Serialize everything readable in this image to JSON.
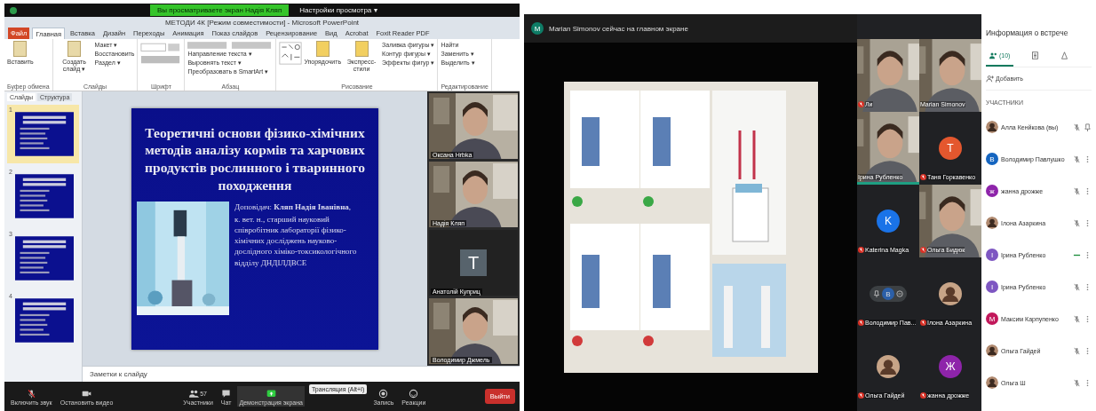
{
  "left_screen": {
    "share_banner": "Вы просматриваете экран Надія Кляп",
    "view_options": "Настройки просмотра ▾",
    "powerpoint": {
      "title": "МЕТОДИ 4К [Режим совместимости] - Microsoft PowerPoint",
      "ribbon_tabs": [
        {
          "label": "Файл",
          "kind": "file",
          "selected": false
        },
        {
          "label": "Главная",
          "kind": "tab",
          "selected": true
        },
        {
          "label": "Вставка",
          "kind": "tab",
          "selected": false
        },
        {
          "label": "Дизайн",
          "kind": "tab",
          "selected": false
        },
        {
          "label": "Переходы",
          "kind": "tab",
          "selected": false
        },
        {
          "label": "Анимация",
          "kind": "tab",
          "selected": false
        },
        {
          "label": "Показ слайдов",
          "kind": "tab",
          "selected": false
        },
        {
          "label": "Рецензирование",
          "kind": "tab",
          "selected": false
        },
        {
          "label": "Вид",
          "kind": "tab",
          "selected": false
        },
        {
          "label": "Acrobat",
          "kind": "tab",
          "selected": false
        },
        {
          "label": "Foxit Reader PDF",
          "kind": "tab",
          "selected": false
        }
      ],
      "ribbon_groups": [
        {
          "label": "Буфер обмена",
          "kind": "large",
          "buttons": [
            "Вставить"
          ]
        },
        {
          "label": "Слайды",
          "kind": "large",
          "buttons": [
            "Создать слайд ▾",
            "Макет ▾",
            "Восстановить",
            "Раздел ▾"
          ]
        },
        {
          "label": "Шрифт",
          "kind": "format"
        },
        {
          "label": "Абзац",
          "kind": "paragraph",
          "buttons": [
            "Направление текста ▾",
            "Выровнять текст ▾",
            "Преобразовать в SmartArt ▾"
          ]
        },
        {
          "label": "Рисование",
          "kind": "drawing",
          "buttons": [
            "Упорядочить",
            "Экспресс-стили",
            "Заливка фигуры ▾",
            "Контур фигуры ▾",
            "Эффекты фигур ▾"
          ]
        },
        {
          "label": "Редактирование",
          "kind": "list",
          "buttons": [
            "Найти",
            "Заменить ▾",
            "Выделить ▾"
          ]
        }
      ],
      "panel_tabs": [
        {
          "label": "Слайды",
          "selected": true
        },
        {
          "label": "Структура",
          "selected": false
        }
      ],
      "thumbnails": [
        {
          "number": "1",
          "selected": true
        },
        {
          "number": "2",
          "selected": false
        },
        {
          "number": "3",
          "selected": false
        },
        {
          "number": "4",
          "selected": false
        }
      ],
      "slide": {
        "title": "Теоретичні основи фізико-хімічних методів аналізу кормів та харчових продуктів рослинного і тваринного походження",
        "speaker": "Доповідач: **Кляп Надія Іванівна**,",
        "details": "к. вет. н., старший науковий співробітник лабораторії фізико-хімічних досліджень науково-дослідного хіміко-токсикологічного відділу ДНДІЛДВСЕ"
      },
      "notes_placeholder": "Заметки к слайду"
    },
    "video_tiles": [
      {
        "name": "Оксана Hrbka",
        "kind": "video"
      },
      {
        "name": "Надія Кляп",
        "kind": "video"
      },
      {
        "name": "Анатолій Куприц",
        "kind": "avatar",
        "initial": "T"
      },
      {
        "name": "Володимир Джмель",
        "kind": "video"
      }
    ],
    "toolbar": [
      {
        "label": "Включить звук",
        "kind": "mic",
        "selected": false
      },
      {
        "label": "Остановить видео",
        "kind": "camera",
        "selected": false
      },
      {
        "label": "Участники",
        "kind": "people",
        "count": "57",
        "selected": false
      },
      {
        "label": "Чат",
        "kind": "chat",
        "selected": false
      },
      {
        "label": "Демонстрация экрана",
        "kind": "share",
        "selected": true
      },
      {
        "label": "Запись",
        "kind": "record",
        "selected": false
      },
      {
        "label": "Реакции",
        "kind": "reactions",
        "selected": false
      }
    ],
    "tooltip": "Трансляция (Alt+I)",
    "leave": "Выйти"
  },
  "right_screen": {
    "presenter_initial": "M",
    "presenter_notice": "Marian Simonov сейчас на главном экране",
    "tiles": [
      {
        "name": "Ли",
        "kind": "video",
        "muted": true,
        "speaking": false
      },
      {
        "name": "Marian Simonov",
        "kind": "video",
        "muted": false,
        "speaking": false
      },
      {
        "name": "Ірина Рубленко",
        "kind": "video",
        "muted": false,
        "speaking": true
      },
      {
        "name": "Таня Горкавенко",
        "kind": "avatar",
        "initial": "T",
        "color": "#e4572e",
        "muted": true,
        "speaking": false
      },
      {
        "name": "Katerina Magka",
        "kind": "avatar",
        "initial": "K",
        "color": "#1a73e8",
        "muted": true,
        "speaking": false
      },
      {
        "name": "Ольга Бидюк",
        "kind": "video",
        "muted": true,
        "speaking": false
      },
      {
        "name": "Володимир Пав...",
        "kind": "hover",
        "initial": "В",
        "muted": true,
        "speaking": false
      },
      {
        "name": "Ілона Азаркина",
        "muted": true,
        "speaking": false
      },
      {
        "name": "Ольга Гайдей",
        "muted": true,
        "speaking": false
      },
      {
        "name": "жанна дрожже",
        "kind": "avatar",
        "initial": "Ж",
        "color": "#8e24aa",
        "muted": true,
        "speaking": false
      }
    ],
    "sidebar": {
      "title": "Информация о встрече",
      "tabs": [
        {
          "kind": "people",
          "label": "(10)",
          "selected": true
        },
        {
          "kind": "chat",
          "selected": false
        },
        {
          "kind": "activities",
          "selected": false
        }
      ],
      "add_label": "Добавить",
      "section": "УЧАСТНИКИ",
      "participants": [
        {
          "name": "Алла Кенйкова (вы)",
          "kind": "self",
          "muted": true
        },
        {
          "name": "Володимир Павлушко",
          "kind": "other",
          "initial": "В",
          "color": "#1565c0",
          "muted": true
        },
        {
          "name": "жанна дрожже",
          "kind": "other",
          "initial": "ж",
          "color": "#8e24aa",
          "muted": true
        },
        {
          "name": "Ілона Азаркина",
          "kind": "other",
          "muted": true
        },
        {
          "name": "Ірина Рубленко",
          "kind": "other",
          "initial": "І",
          "color": "#7e57c2",
          "muted": false
        },
        {
          "name": "Ірина Рубленко",
          "kind": "other",
          "initial": "І",
          "color": "#7e57c2",
          "muted": true
        },
        {
          "name": "Максим Карпупенко",
          "kind": "other",
          "initial": "М",
          "color": "#c2185b",
          "muted": true
        },
        {
          "name": "Ольга Гайдей",
          "kind": "other",
          "muted": true
        },
        {
          "name": "Ольга Ш",
          "kind": "other",
          "muted": true
        }
      ]
    }
  }
}
